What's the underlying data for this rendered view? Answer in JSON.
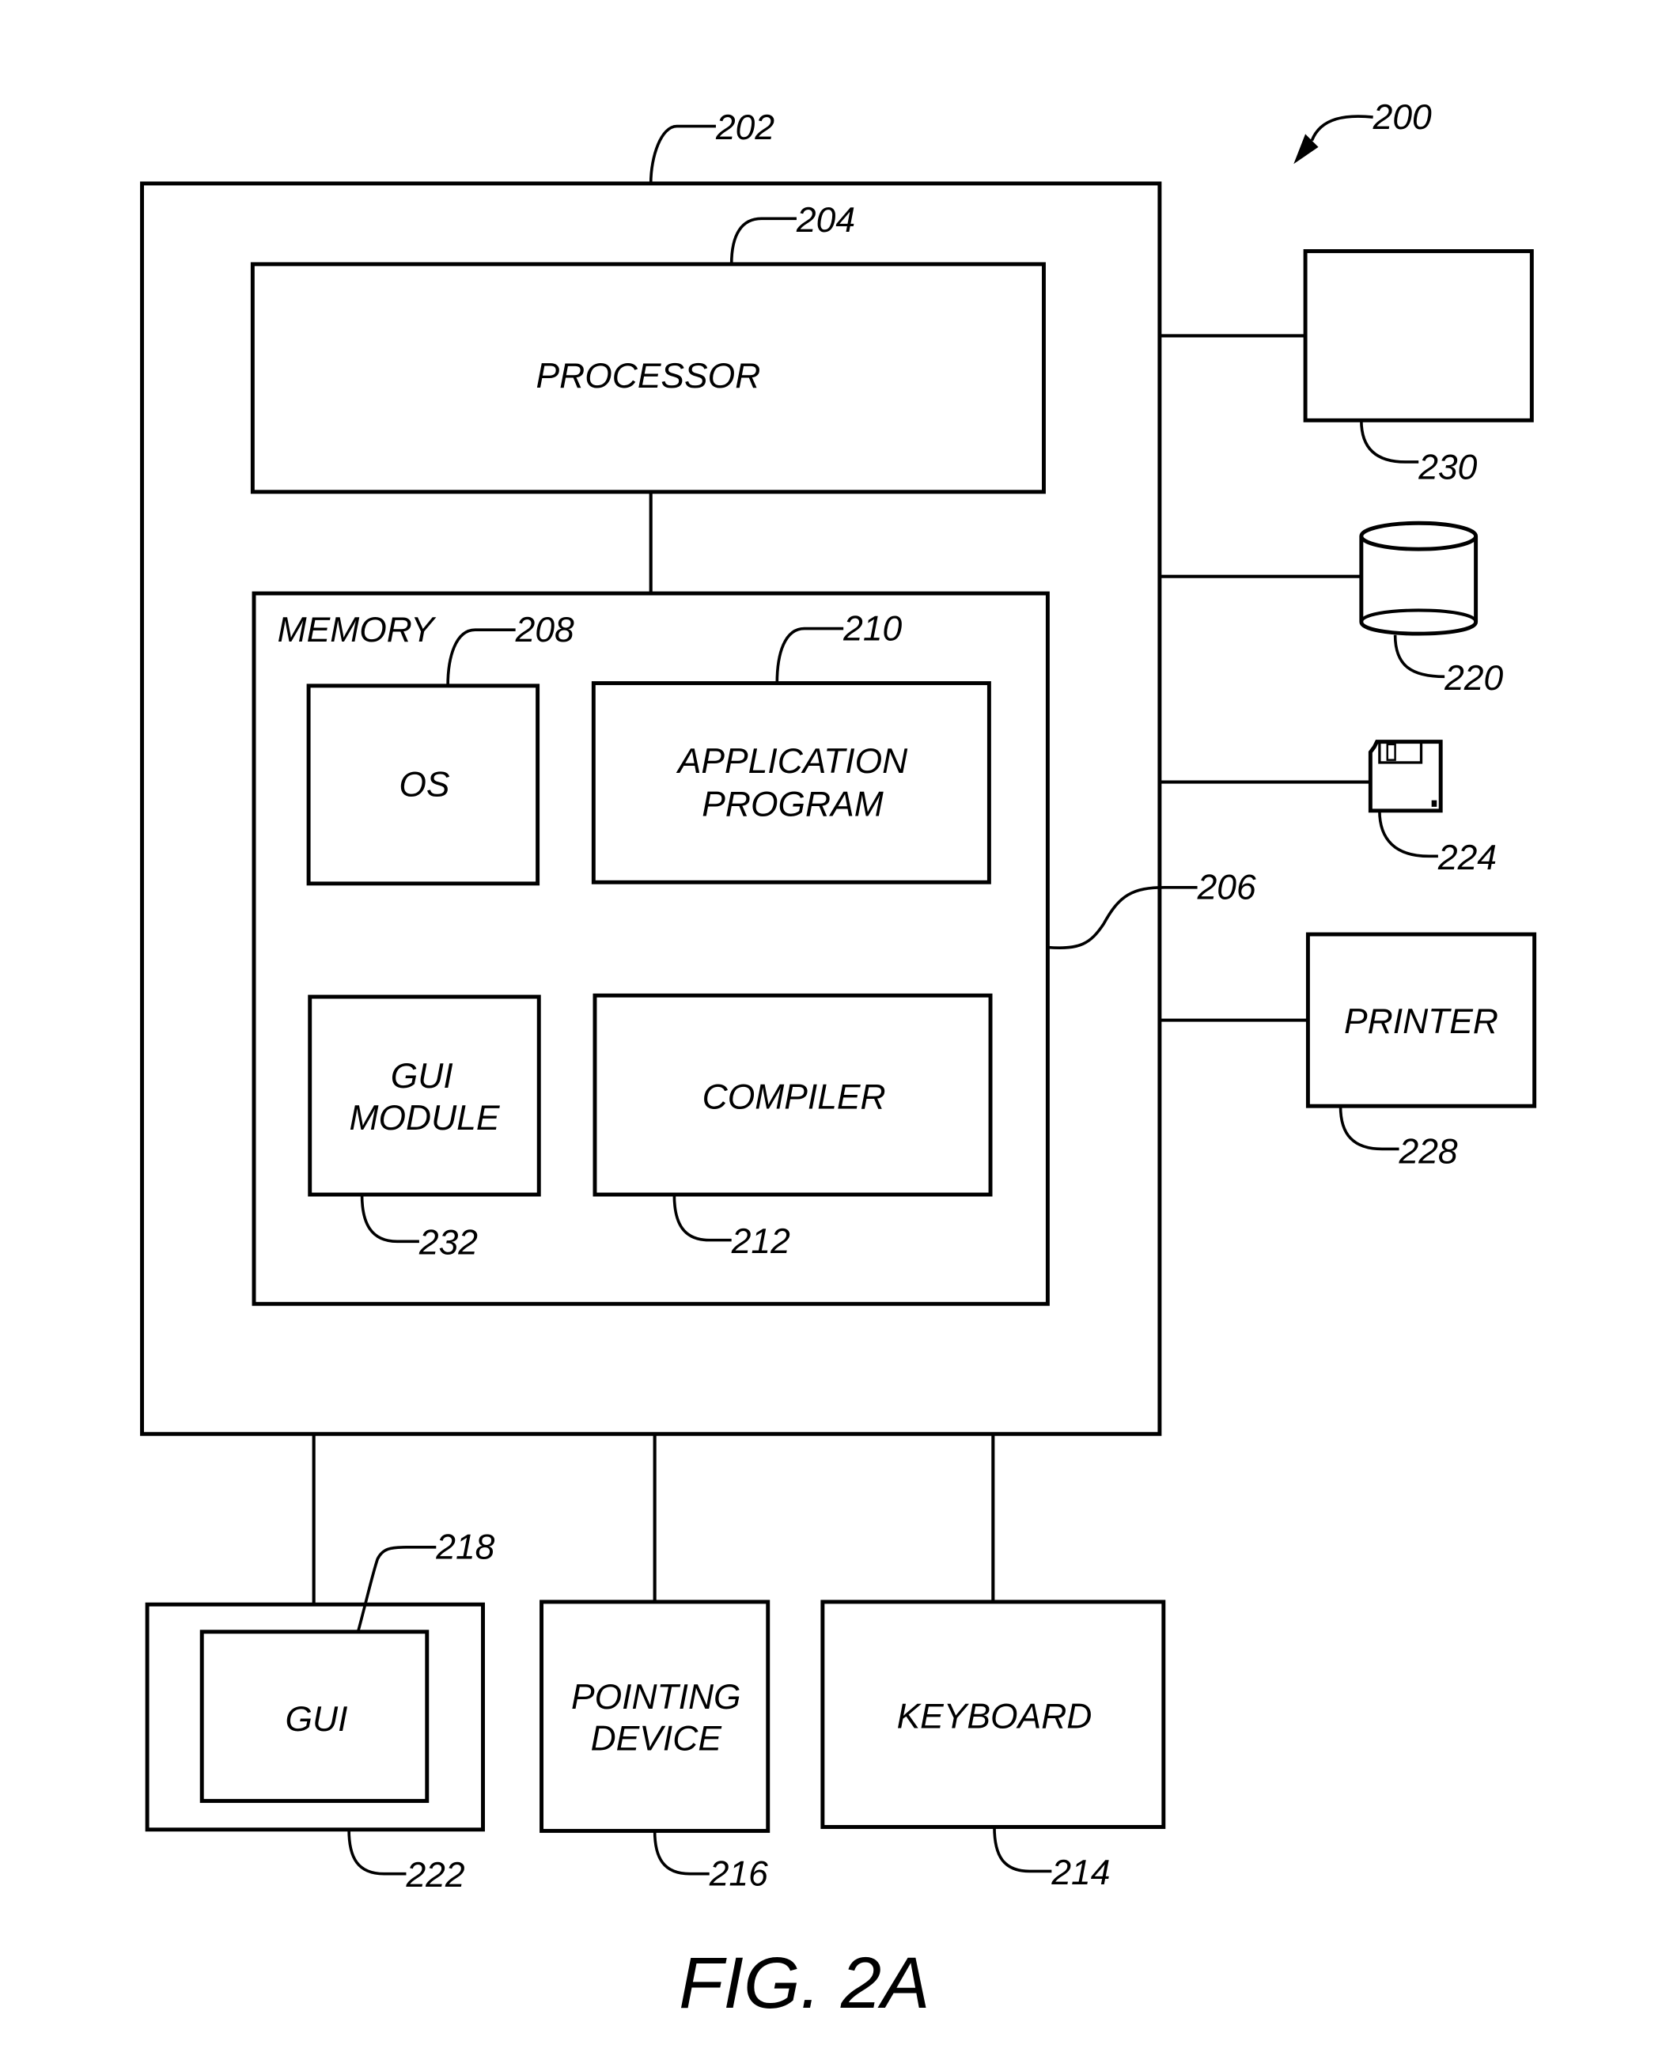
{
  "figure": {
    "caption": "FIG. 2A",
    "system_ref": "200"
  },
  "computer": {
    "ref": "202"
  },
  "processor": {
    "label": "PROCESSOR",
    "ref": "204"
  },
  "bus": {
    "ref": "206"
  },
  "memory": {
    "label": "MEMORY",
    "ref": "208",
    "os": {
      "label": "OS"
    },
    "application": {
      "line1": "APPLICATION",
      "line2": "PROGRAM",
      "ref": "210"
    },
    "gui_module": {
      "line1": "GUI",
      "line2": "MODULE",
      "ref": "232"
    },
    "compiler": {
      "label": "COMPILER",
      "ref": "212"
    }
  },
  "peripherals": {
    "network_device": {
      "ref": "230"
    },
    "storage": {
      "ref": "220"
    },
    "floppy": {
      "ref": "224"
    },
    "printer": {
      "label": "PRINTER",
      "ref": "228"
    }
  },
  "io": {
    "display": {
      "ref": "222",
      "gui": {
        "label": "GUI",
        "ref": "218"
      }
    },
    "pointing_device": {
      "line1": "POINTING",
      "line2": "DEVICE",
      "ref": "216"
    },
    "keyboard": {
      "label": "KEYBOARD",
      "ref": "214"
    }
  }
}
